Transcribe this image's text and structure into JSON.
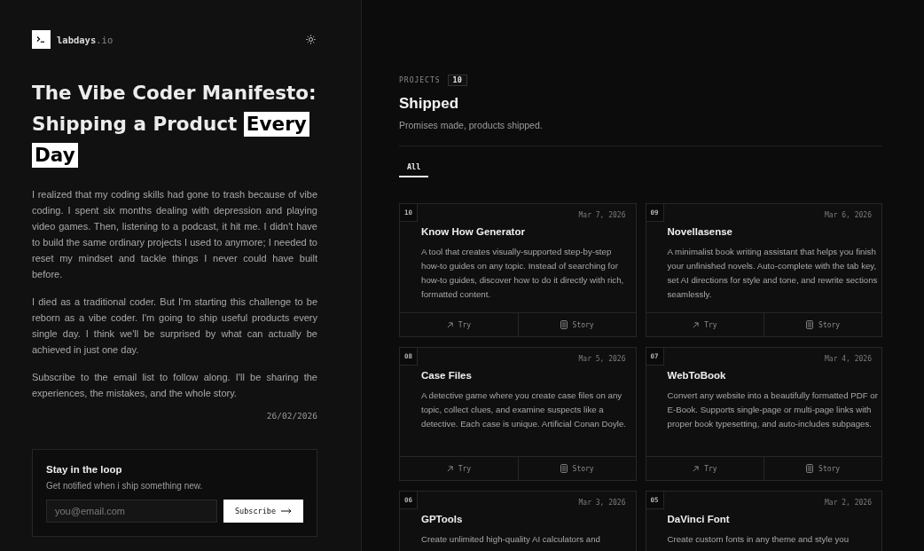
{
  "brand": {
    "name": "labdays",
    "suffix": ".io"
  },
  "article": {
    "title": "The Vibe Coder Manifesto: Shipping a Product",
    "title_highlight": "Every Day",
    "paragraphs": [
      "I realized that my coding skills had gone to trash because of vibe coding. I spent six months dealing with depression and playing video games. Then, listening to a podcast, it hit me. I didn't have to build the same ordinary projects I used to anymore; I needed to reset my mindset and tackle things I never could have built before.",
      "I died as a traditional coder. But I'm starting this challenge to be reborn as a vibe coder. I'm going to ship useful products every single day. I think we'll be surprised by what can actually be achieved in just one day.",
      "Subscribe to the email list to follow along. I'll be sharing the experiences, the mistakes, and the whole story."
    ],
    "date": "26/02/2026"
  },
  "newsletter": {
    "heading": "Stay in the loop",
    "text": "Get notified when i ship something new.",
    "placeholder": "you@email.com",
    "button": "Subscribe"
  },
  "projects": {
    "eyebrow": "PROJECTS",
    "count": "10",
    "title": "Shipped",
    "subtitle": "Promises made, products shipped.",
    "filters": [
      {
        "label": "All",
        "selected": true
      }
    ],
    "items": [
      {
        "number": "10",
        "date": "Mar 7, 2026",
        "title": "Know How Generator",
        "description": "A tool that creates visually-supported step-by-step how-to guides on any topic. Instead of searching for how-to guides, discover how to do it directly with rich, formatted content.",
        "actions": [
          {
            "kind": "try",
            "label": "Try"
          },
          {
            "kind": "story",
            "label": "Story"
          }
        ]
      },
      {
        "number": "09",
        "date": "Mar 6, 2026",
        "title": "Novellasense",
        "description": "A minimalist book writing assistant that helps you finish your unfinished novels. Auto-complete with the tab key, set AI directions for style and tone, and rewrite sections seamlessly.",
        "actions": [
          {
            "kind": "try",
            "label": "Try"
          },
          {
            "kind": "story",
            "label": "Story"
          }
        ]
      },
      {
        "number": "08",
        "date": "Mar 5, 2026",
        "title": "Case Files",
        "description": "A detective game where you create case files on any topic, collect clues, and examine suspects like a detective. Each case is unique. Artificial Conan Doyle.",
        "actions": [
          {
            "kind": "try",
            "label": "Try"
          },
          {
            "kind": "story",
            "label": "Story"
          }
        ]
      },
      {
        "number": "07",
        "date": "Mar 4, 2026",
        "title": "WebToBook",
        "description": "Convert any website into a beautifully formatted PDF or E-Book. Supports single-page or multi-page links with proper book typesetting, and auto-includes subpages.",
        "actions": [
          {
            "kind": "try",
            "label": "Try"
          },
          {
            "kind": "story",
            "label": "Story"
          }
        ]
      },
      {
        "number": "06",
        "date": "Mar 3, 2026",
        "title": "GPTools",
        "description": "Create unlimited high-quality AI calculators and"
      },
      {
        "number": "05",
        "date": "Mar 2, 2026",
        "title": "DaVinci Font",
        "description": "Create custom fonts in any theme and style you"
      }
    ]
  }
}
